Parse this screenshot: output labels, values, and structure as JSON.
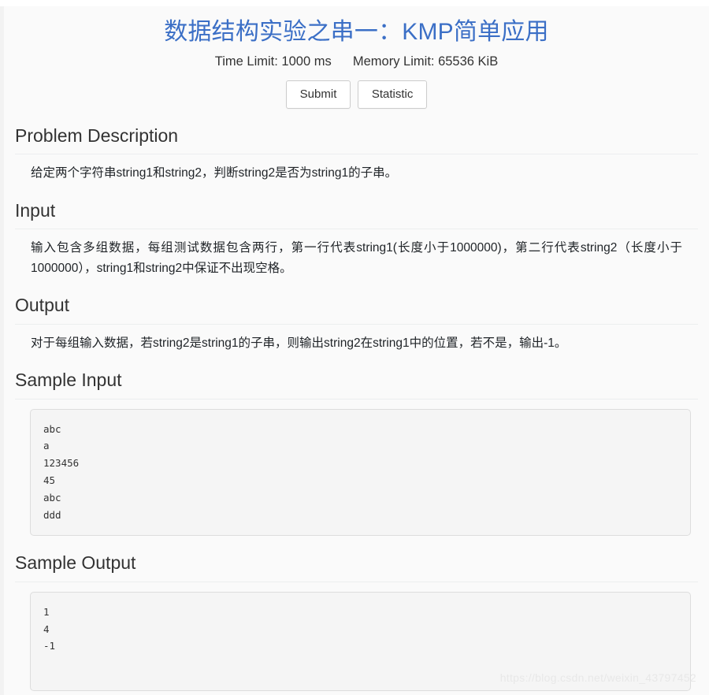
{
  "header": {
    "title": "数据结构实验之串一：KMP简单应用",
    "time_limit": "Time Limit: 1000 ms",
    "memory_limit": "Memory Limit: 65536 KiB",
    "title_color": "#3b6fc6"
  },
  "actions": {
    "submit_label": "Submit",
    "statistic_label": "Statistic"
  },
  "sections": [
    {
      "key": "description",
      "title": "Problem Description",
      "body": "给定两个字符串string1和string2，判断string2是否为string1的子串。"
    },
    {
      "key": "input",
      "title": "Input",
      "body": "输入包含多组数据，每组测试数据包含两行，第一行代表string1(长度小于1000000)，第二行代表string2（长度小于1000000），string1和string2中保证不出现空格。"
    },
    {
      "key": "output",
      "title": "Output",
      "body": "对于每组输入数据，若string2是string1的子串，则输出string2在string1中的位置，若不是，输出-1。"
    }
  ],
  "sample_input": {
    "title": "Sample Input",
    "code": "abc\na\n123456\n45\nabc\nddd"
  },
  "sample_output": {
    "title": "Sample Output",
    "code": "1\n4\n-1"
  },
  "watermark": {
    "text": "https://blog.csdn.net/weixin_43797452"
  }
}
